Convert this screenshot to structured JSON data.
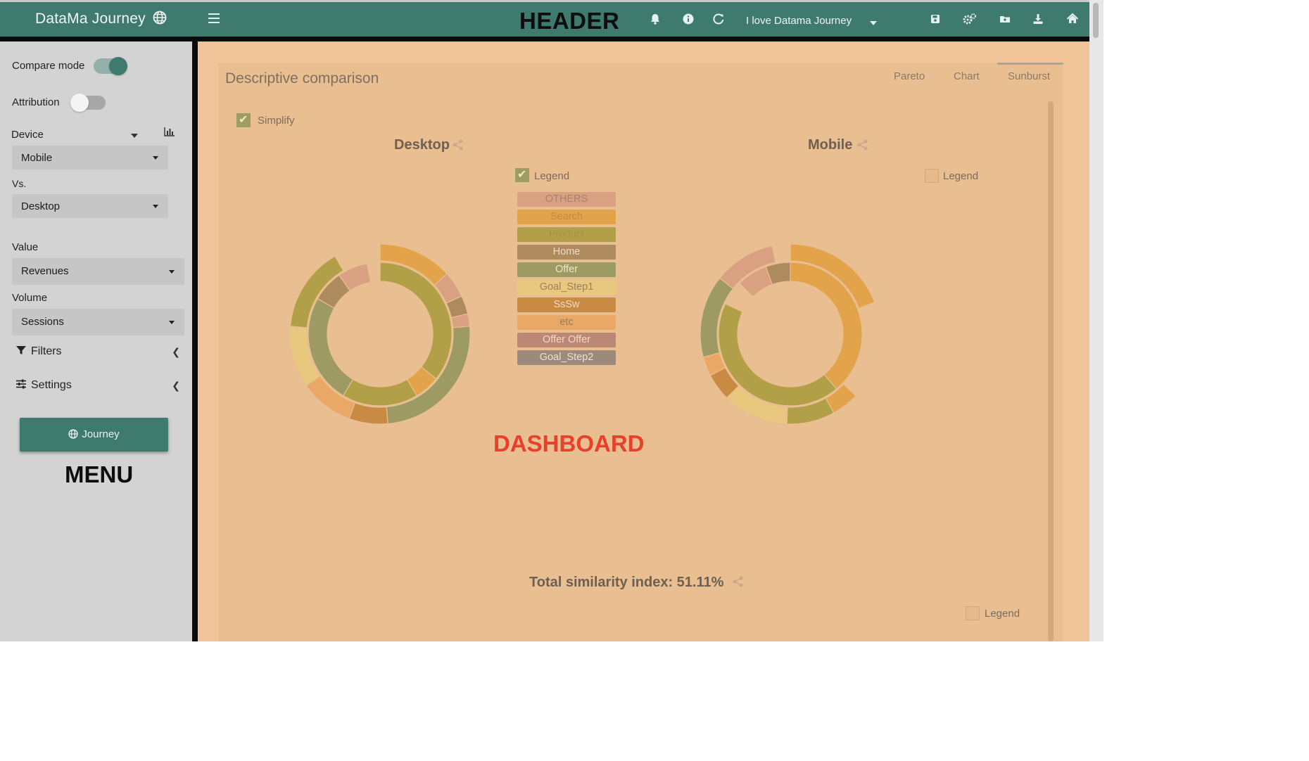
{
  "header": {
    "app_title": "DataMa Journey",
    "annotation": "HEADER",
    "journey_select": "I love Datama Journey",
    "icons": [
      "bell-icon",
      "info-icon",
      "refresh-icon",
      "save-icon",
      "settings-icon",
      "folder-icon",
      "download-icon",
      "home-icon"
    ]
  },
  "sidebar": {
    "compare_mode": {
      "label": "Compare mode",
      "on": true
    },
    "attribution": {
      "label": "Attribution",
      "on": false
    },
    "device": {
      "label": "Device",
      "value": "Mobile"
    },
    "vs": {
      "label": "Vs.",
      "value": "Desktop"
    },
    "value": {
      "label": "Value",
      "value": "Revenues"
    },
    "volume": {
      "label": "Volume",
      "value": "Sessions"
    },
    "filters_label": "Filters",
    "settings_label": "Settings",
    "journey_button": "Journey",
    "annotation": "MENU"
  },
  "dashboard": {
    "title": "Descriptive comparison",
    "tabs": [
      {
        "label": "Pareto",
        "active": false
      },
      {
        "label": "Chart",
        "active": false
      },
      {
        "label": "Sunburst",
        "active": true
      }
    ],
    "simplify": {
      "label": "Simplify",
      "checked": true
    },
    "desktop": {
      "title": "Desktop",
      "legend_label": "Legend",
      "legend_checked": true
    },
    "mobile": {
      "title": "Mobile",
      "legend_label": "Legend",
      "legend_checked": false
    },
    "bottom_legend": {
      "label": "Legend",
      "checked": false
    },
    "legend_items": [
      {
        "label": "OTHERS",
        "color": "#d9a182",
        "text": "#a8806e"
      },
      {
        "label": "Search",
        "color": "#e2a34b",
        "text": "#c58a3a"
      },
      {
        "label": "Product",
        "color": "#b2a048",
        "text": "#a39446"
      },
      {
        "label": "Home",
        "color": "#ae8a5f",
        "text": "#f0dbc2"
      },
      {
        "label": "Offer",
        "color": "#9d9a63",
        "text": "#f3e5c6"
      },
      {
        "label": "Goal_Step1",
        "color": "#e8c77e",
        "text": "#9b8161"
      },
      {
        "label": "SsSw",
        "color": "#c98b44",
        "text": "#f1dcbe"
      },
      {
        "label": "etc",
        "color": "#eaa866",
        "text": "#987a5b"
      },
      {
        "label": "Offer Offer",
        "color": "#bc8773",
        "text": "#f0dbc8"
      },
      {
        "label": "Goal_Step2",
        "color": "#9c8a7c",
        "text": "#ece0d4"
      }
    ],
    "similarity_text": "Total similarity index: 51.11%",
    "annotation": "DASHBOARD"
  },
  "chart_data": [
    {
      "type": "sunburst",
      "title": "Desktop",
      "rings": [
        [
          {
            "value": 100,
            "color": "#b2a048"
          },
          {
            "value": 16,
            "color": "#e2a34b"
          },
          {
            "value": 48,
            "color": "#b2a048"
          },
          {
            "value": 69,
            "color": "#9d9a63"
          },
          {
            "value": 20,
            "color": "#ae8a5f"
          },
          {
            "value": 19,
            "color": "#d9a182"
          },
          {
            "value": 8,
            "color": "#e9be90"
          }
        ],
        [
          {
            "value": 48,
            "color": "#e2a34b"
          },
          {
            "value": 17,
            "color": "#d9a182"
          },
          {
            "value": 12,
            "color": "#ae8a5f"
          },
          {
            "value": 8,
            "color": "#d9a182"
          },
          {
            "value": 90,
            "color": "#9d9a63"
          },
          {
            "value": 25,
            "color": "#c98b44"
          },
          {
            "value": 35,
            "color": "#eaa866"
          },
          {
            "value": 40,
            "color": "#e8c77e"
          },
          {
            "value": 55,
            "color": "#b2a048"
          },
          {
            "value": 30,
            "color": "#e9be90"
          }
        ]
      ]
    },
    {
      "type": "sunburst",
      "title": "Mobile",
      "rings": [
        [
          {
            "value": 140,
            "color": "#e2a34b"
          },
          {
            "value": 155,
            "color": "#b2a048"
          },
          {
            "value": 20,
            "color": "#e9be90"
          },
          {
            "value": 25,
            "color": "#d9a182"
          },
          {
            "value": 20,
            "color": "#ae8a5f"
          }
        ],
        [
          {
            "value": 78,
            "color": "#e2a34b"
          },
          {
            "value": 72,
            "color": "#e9be90"
          },
          {
            "value": 20,
            "color": "#e2a34b"
          },
          {
            "value": 35,
            "color": "#b2a048"
          },
          {
            "value": 48,
            "color": "#e8c77e"
          },
          {
            "value": 20,
            "color": "#c98b44"
          },
          {
            "value": 14,
            "color": "#eaa866"
          },
          {
            "value": 60,
            "color": "#9d9a63"
          },
          {
            "value": 45,
            "color": "#d9a182"
          },
          {
            "value": 13,
            "color": "#e9be90"
          }
        ]
      ]
    }
  ]
}
